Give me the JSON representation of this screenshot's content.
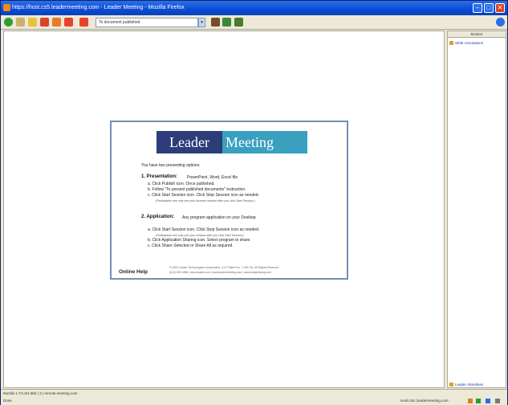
{
  "window": {
    "title": "https://host.cs5.leadermeeting.com - Leader Meeting - Mozilla Firefox",
    "accent": "#0a4bd6"
  },
  "toolbar": {
    "address_value": "To document published",
    "icons": [
      "back-icon",
      "forward-icon",
      "search-icon",
      "bookmark-icon",
      "prev-icon",
      "next-icon",
      "print-icon",
      "home-icon",
      "tools-icon",
      "help-icon"
    ]
  },
  "sidebar": {
    "header": "Monitor",
    "top_link": "Write Annotations",
    "bottom_link": "Leader Attendees"
  },
  "meeting": {
    "logo_left": "Leader",
    "logo_right": "Meeting",
    "intro": "You have two presenting options:",
    "opt1_title": "1. Presentation:",
    "opt1_desc": "PowerPoint, Word, Excel file",
    "opt1_a": "a. Click Publish icon. Once published,",
    "opt1_b": "b. Follow \"To present published documents\" instruction.",
    "opt1_c": "c. Click Start Session icon. Click Stop Session icon as needed.",
    "opt1_note": "(Participants see only one your browser window after you click Start Session.)",
    "opt2_title": "2. Application:",
    "opt2_desc": "Any program application on your Desktop",
    "opt2_a": "a. Click Start Session icon. Click Stop Session icon as needed.",
    "opt2_note": "(Participants see only one your window after you click Start Session.)",
    "opt2_b": "b. Click Application Sharing icon. Select program to share.",
    "opt2_c": "c. Click Share Selected or Share All as required.",
    "online_help": "Online Help",
    "copyright1": "© 2003 Leader Technologies Incorporated. U.S. Patent No. 7,139,761. All Rights Reserved.",
    "copyright2": "(614) 890-1986 | www.leader.com | www.leadermeeting.com | www.leaderdialog.com"
  },
  "status": {
    "left1": "Mozilla 1.7/1.0/1.8b2 | 2 | remote.meeting.com",
    "left2": "Done",
    "right": "Host:cs5 | leadermeeting.com"
  }
}
